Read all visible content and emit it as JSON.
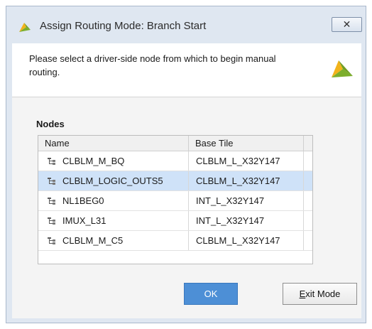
{
  "window": {
    "title": "Assign Routing Mode: Branch Start",
    "close_glyph": "✕"
  },
  "header": {
    "message": "Please select a driver-side node from which to begin manual routing."
  },
  "nodes": {
    "section_label": "Nodes",
    "columns": [
      "Name",
      "Base Tile"
    ],
    "rows": [
      {
        "name": "CLBLM_M_BQ",
        "tile": "CLBLM_L_X32Y147",
        "selected": false
      },
      {
        "name": "CLBLM_LOGIC_OUTS5",
        "tile": "CLBLM_L_X32Y147",
        "selected": true
      },
      {
        "name": "NL1BEG0",
        "tile": "INT_L_X32Y147",
        "selected": false
      },
      {
        "name": "IMUX_L31",
        "tile": "INT_L_X32Y147",
        "selected": false
      },
      {
        "name": "CLBLM_M_C5",
        "tile": "CLBLM_L_X32Y147",
        "selected": false
      }
    ],
    "row_icon": "node-tree-icon"
  },
  "buttons": {
    "ok_label": "OK",
    "exit_mnemonic": "E",
    "exit_rest": "xit Mode"
  },
  "colors": {
    "selection": "#cfe2f8",
    "ok_button": "#4d8fd6",
    "logo_green": "#6f9e23",
    "logo_yellow": "#f2b31b"
  }
}
